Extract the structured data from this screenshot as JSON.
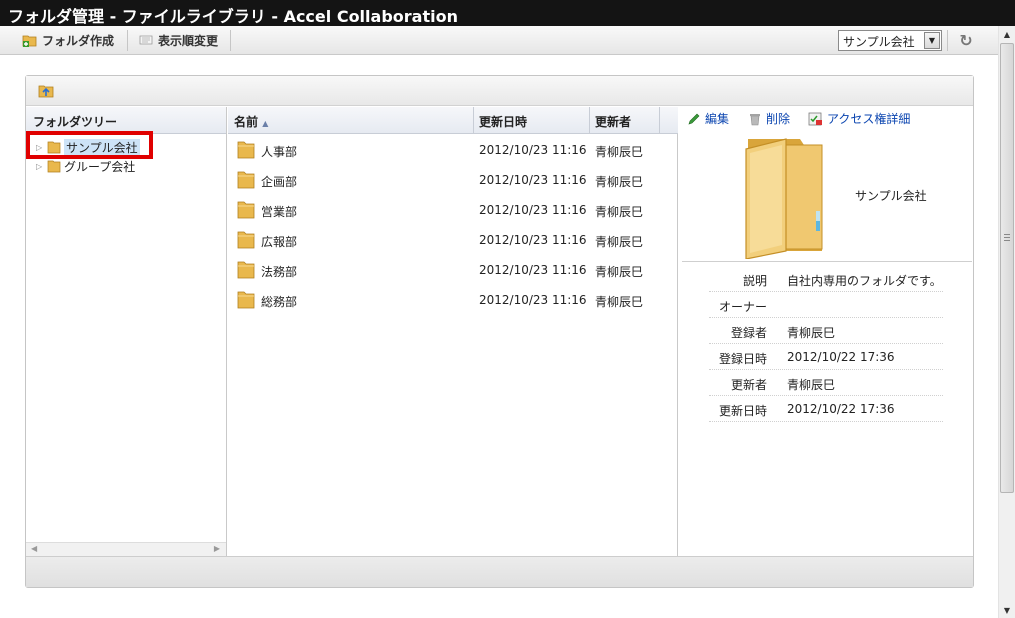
{
  "window": {
    "title": "フォルダ管理 - ファイルライブラリ - Accel Collaboration"
  },
  "toolbar": {
    "create_folder_label": "フォルダ作成",
    "reorder_label": "表示順変更",
    "org_select": {
      "selected": "サンプル会社"
    }
  },
  "tree": {
    "header": "フォルダツリー",
    "nodes": [
      {
        "label": "サンプル会社",
        "selected": true
      },
      {
        "label": "グループ会社",
        "selected": false
      }
    ]
  },
  "list": {
    "columns": {
      "name": "名前",
      "updated_at": "更新日時",
      "updated_by": "更新者"
    },
    "rows": [
      {
        "name": "人事部",
        "updated_at": "2012/10/23 11:16",
        "updated_by": "青柳辰巳"
      },
      {
        "name": "企画部",
        "updated_at": "2012/10/23 11:16",
        "updated_by": "青柳辰巳"
      },
      {
        "name": "営業部",
        "updated_at": "2012/10/23 11:16",
        "updated_by": "青柳辰巳"
      },
      {
        "name": "広報部",
        "updated_at": "2012/10/23 11:16",
        "updated_by": "青柳辰巳"
      },
      {
        "name": "法務部",
        "updated_at": "2012/10/23 11:16",
        "updated_by": "青柳辰巳"
      },
      {
        "name": "総務部",
        "updated_at": "2012/10/23 11:16",
        "updated_by": "青柳辰巳"
      }
    ]
  },
  "detail": {
    "actions": {
      "edit": "編集",
      "delete": "削除",
      "access": "アクセス権詳細"
    },
    "folder_name": "サンプル会社",
    "fields": [
      {
        "key": "説明",
        "value": "自社内専用のフォルダです。"
      },
      {
        "key": "オーナー",
        "value": ""
      },
      {
        "key": "登録者",
        "value": "青柳辰巳"
      },
      {
        "key": "登録日時",
        "value": "2012/10/22 17:36"
      },
      {
        "key": "更新者",
        "value": "青柳辰巳"
      },
      {
        "key": "更新日時",
        "value": "2012/10/22 17:36"
      }
    ]
  },
  "colors": {
    "highlight": "#e00000",
    "link": "#0b45b0",
    "folder": "#e9b84d"
  }
}
